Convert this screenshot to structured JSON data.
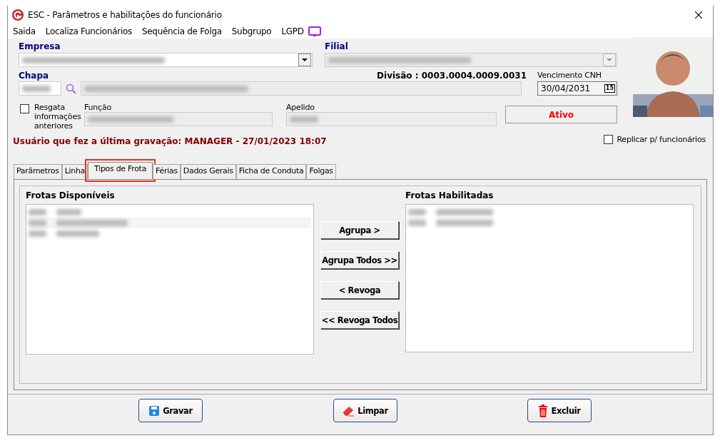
{
  "window": {
    "title": "ESC - Parâmetros e habilitações do funcionário"
  },
  "menu": [
    "Saida",
    "Localiza Funcionários",
    "Sequência de Folga",
    "Subgrupo",
    "LGPD"
  ],
  "form": {
    "empresa_label": "Empresa",
    "filial_label": "Filial",
    "filial_disabled": true,
    "chapa_label": "Chapa",
    "divisao": "Divisão : 0003.0004.0009.0031",
    "cnh_label": "Vencimento  CNH",
    "cnh_value": "30/04/2031",
    "calendar_key": "15",
    "resgata": {
      "label": "Resgata informações anteriores",
      "checked": false
    },
    "funcao_label": "Função",
    "apelido_label": "Apelido",
    "status": "Ativo",
    "replicar": {
      "label": "Replicar p/ funcionários",
      "checked": false
    }
  },
  "last_saved": "Usuário que fez a última gravação: MANAGER - 27/01/2023 18:07",
  "tabs": [
    {
      "label": "Parâmetros",
      "selected": false,
      "highlighted": false
    },
    {
      "label": "Linha",
      "selected": false,
      "highlighted": false
    },
    {
      "label": "Tipos de Frota",
      "selected": true,
      "highlighted": true
    },
    {
      "label": "Férias",
      "selected": false,
      "highlighted": false
    },
    {
      "label": "Dados Gerais",
      "selected": false,
      "highlighted": false
    },
    {
      "label": "Ficha de Conduta",
      "selected": false,
      "highlighted": false
    },
    {
      "label": "Folgas",
      "selected": false,
      "highlighted": false
    }
  ],
  "available": {
    "title": "Frotas Disponíveis"
  },
  "enabled": {
    "title": "Frotas Habilitadas"
  },
  "transfer_buttons": [
    "Agrupa >",
    "Agrupa Todos >>",
    "< Revoga",
    "<< Revoga Todos"
  ],
  "actions": [
    {
      "label": "Gravar",
      "kind": "save"
    },
    {
      "label": "Limpar",
      "kind": "clear"
    },
    {
      "label": "Excluir",
      "kind": "delete"
    }
  ]
}
